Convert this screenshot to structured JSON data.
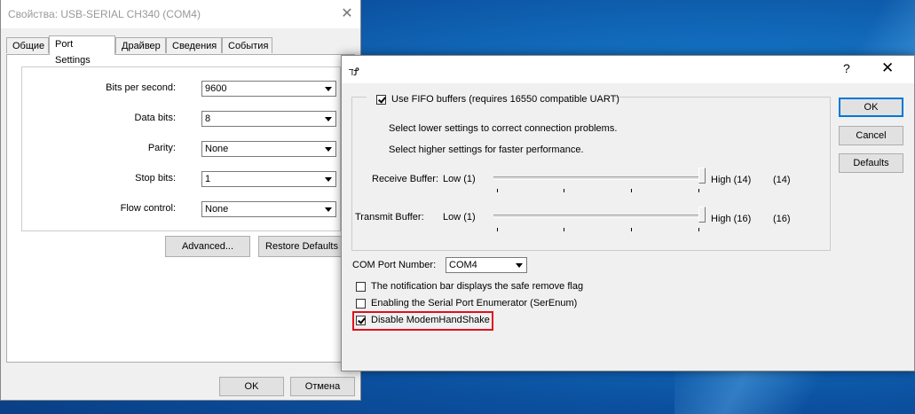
{
  "back_window": {
    "title": "Свойства: USB-SERIAL CH340 (COM4)",
    "tabs": [
      "Общие",
      "Port Settings",
      "Драйвер",
      "Сведения",
      "События"
    ],
    "active_tab": "Port Settings",
    "settings": [
      {
        "label": "Bits per second:",
        "value": "9600"
      },
      {
        "label": "Data bits:",
        "value": "8"
      },
      {
        "label": "Parity:",
        "value": "None"
      },
      {
        "label": "Stop bits:",
        "value": "1"
      },
      {
        "label": "Flow control:",
        "value": "None"
      }
    ],
    "advanced_label": "Advanced...",
    "restore_label": "Restore Defaults",
    "ok_label": "OK",
    "cancel_label": "Отмена"
  },
  "dialog": {
    "title": "ℸꝬ",
    "help_glyph": "?",
    "close_glyph": "✕",
    "fifo_label": "Use FIFO buffers (requires 16550 compatible UART)",
    "fifo_checked": true,
    "hint_lower": "Select lower settings to correct connection problems.",
    "hint_higher": "Select higher settings for faster performance.",
    "receive": {
      "label": "Receive Buffer:",
      "low": "Low (1)",
      "high": "High (14)",
      "value": "(14)",
      "level": 1.0
    },
    "transmit": {
      "label": "Transmit Buffer:",
      "low": "Low (1)",
      "high": "High (16)",
      "value": "(16)",
      "level": 1.0
    },
    "com_port_label": "COM Port Number:",
    "com_port_value": "COM4",
    "options": [
      {
        "label": "The notification bar displays the safe remove flag",
        "checked": false
      },
      {
        "label": "Enabling the Serial Port Enumerator (SerEnum)",
        "checked": false
      },
      {
        "label": "Disable ModemHandShake",
        "checked": true
      }
    ],
    "ok_label": "OK",
    "cancel_label": "Cancel",
    "defaults_label": "Defaults"
  },
  "colors": {
    "highlight": "#e0101e",
    "accent": "#0078d7"
  }
}
